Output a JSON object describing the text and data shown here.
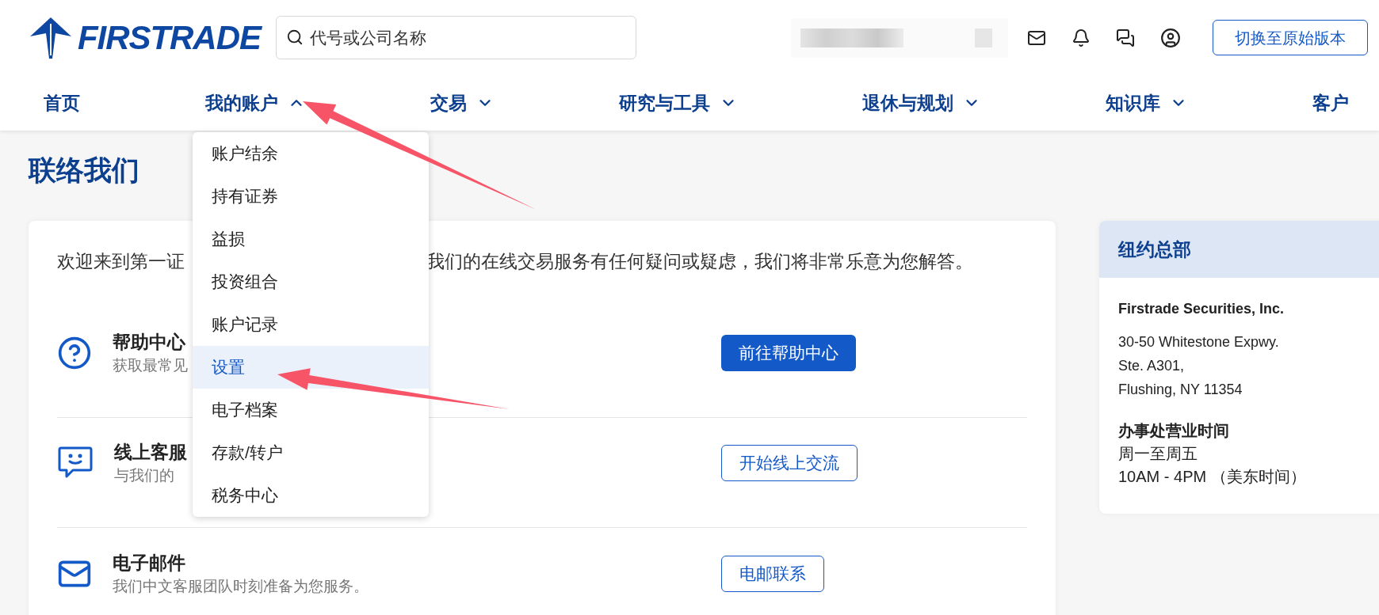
{
  "logo": {
    "text": "FIRSTRADE"
  },
  "search": {
    "placeholder": "代号或公司名称"
  },
  "header_button": "切换至原始版本",
  "nav": [
    {
      "label": "首页",
      "kind": "link"
    },
    {
      "label": "我的账户",
      "kind": "menu",
      "expanded": true
    },
    {
      "label": "交易",
      "kind": "menu",
      "expanded": false
    },
    {
      "label": "研究与工具",
      "kind": "menu",
      "expanded": false
    },
    {
      "label": "退休与规划",
      "kind": "menu",
      "expanded": false
    },
    {
      "label": "知识库",
      "kind": "menu",
      "expanded": false
    },
    {
      "label": "客户",
      "kind": "link"
    }
  ],
  "account_menu": {
    "items": [
      {
        "label": "账户结余",
        "selected": false
      },
      {
        "label": "持有证券",
        "selected": false
      },
      {
        "label": "益损",
        "selected": false
      },
      {
        "label": "投资组合",
        "selected": false
      },
      {
        "label": "账户记录",
        "selected": false
      },
      {
        "label": "设置",
        "selected": true
      },
      {
        "label": "电子档案",
        "selected": false
      },
      {
        "label": "存款/转户",
        "selected": false
      },
      {
        "label": "税务中心",
        "selected": false
      }
    ]
  },
  "page_title": "联络我们",
  "intro": {
    "text_left": "欢迎来到第一证",
    "text_right": "我们的在线交易服务有任何疑问或疑虑，我们将非常乐意为您解答。"
  },
  "contacts": [
    {
      "kind": "help",
      "title": "帮助中心",
      "subtitle": "获取最常见",
      "button": {
        "label": "前往帮助中心",
        "primary": true
      }
    },
    {
      "kind": "chat",
      "title": "线上客服",
      "subtitle": "与我们的",
      "button": {
        "label": "开始线上交流",
        "primary": false
      }
    },
    {
      "kind": "email",
      "title": "电子邮件",
      "subtitle": "我们中文客服团队时刻准备为您服务。",
      "button": {
        "label": "电邮联系",
        "primary": false
      }
    }
  ],
  "office": {
    "title": "纽约总部",
    "company": "Firstrade Securities, Inc.",
    "address": [
      "30-50 Whitestone Expwy.",
      "Ste. A301,",
      "Flushing, NY 11354"
    ],
    "hours_title": "办事处营业时间",
    "hours": [
      "周一至周五",
      "10AM - 4PM （美东时间）"
    ]
  }
}
